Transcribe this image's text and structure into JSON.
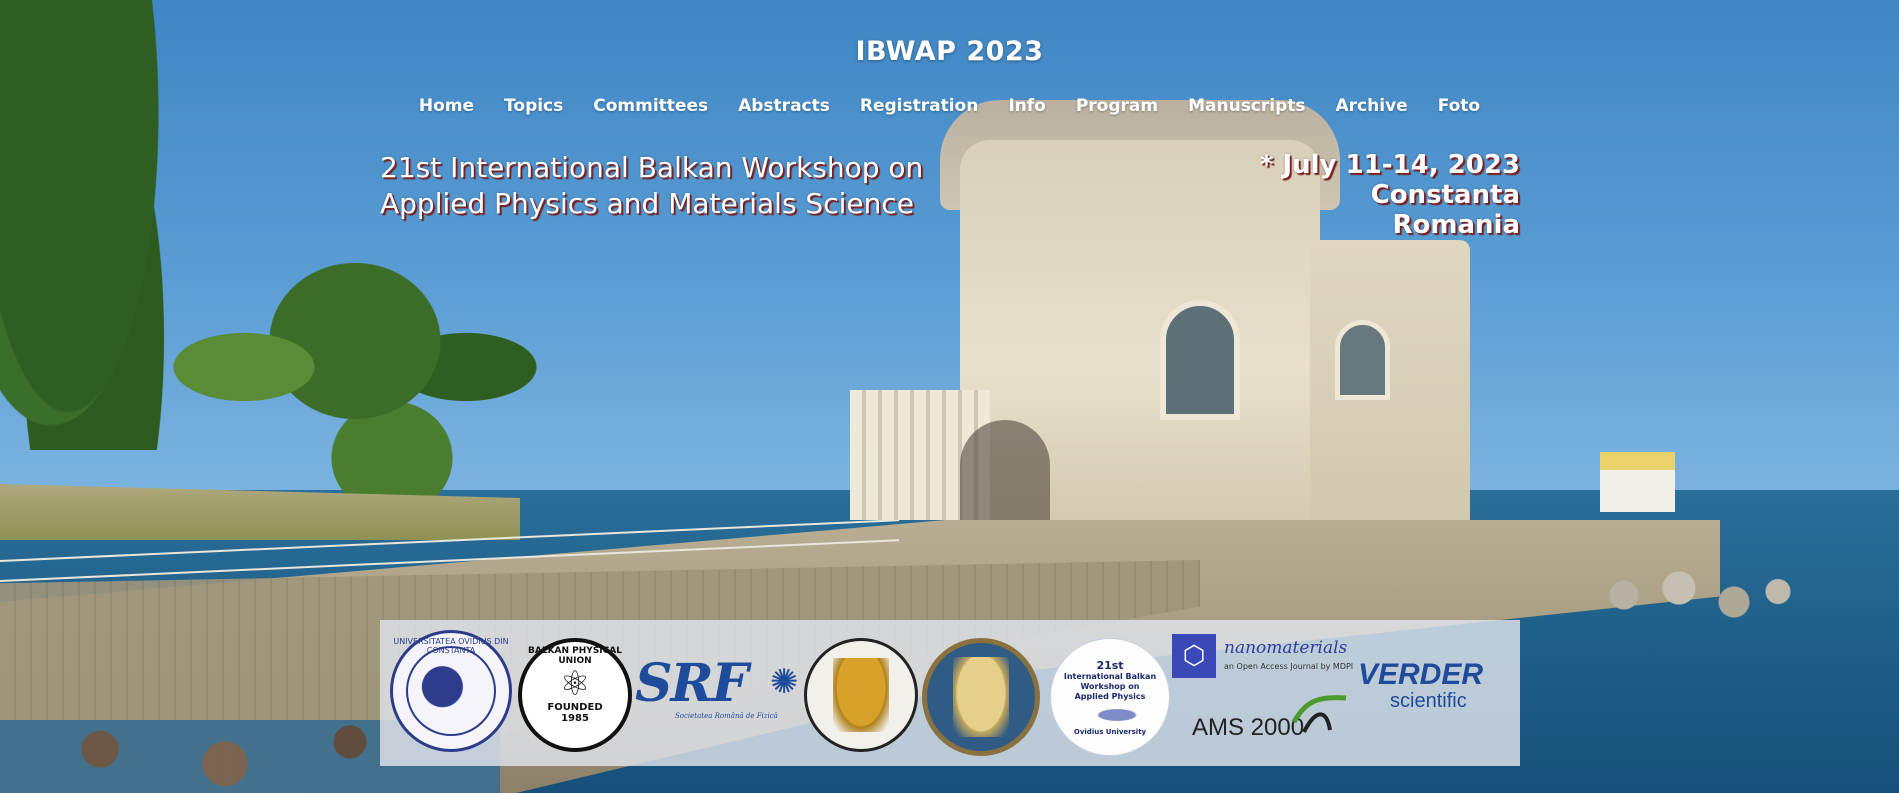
{
  "header": {
    "site_title": "IBWAP 2023",
    "nav": [
      "Home",
      "Topics",
      "Committees",
      "Abstracts",
      "Registration",
      "Info",
      "Program",
      "Manuscripts",
      "Archive",
      "Foto"
    ]
  },
  "hero": {
    "workshop_line1": "21st International Balkan Workshop on",
    "workshop_line2": "Applied Physics and Materials Science",
    "date": "* July 11-14, 2023",
    "city": "Constanta",
    "country": "Romania"
  },
  "logos": {
    "ovidius_ring": "UNIVERSITATEA OVIDIUS DIN CONSTANTA",
    "bpu_arc": "BALKAN PHYSICAL UNION",
    "bpu_founded": "FOUNDED",
    "bpu_year": "1985",
    "srf_mark": "SRF",
    "srf_sub": "Societatea Română de Fizică",
    "ibwap_sup": "21st",
    "ibwap_line1": "International Balkan",
    "ibwap_line2": "Workshop on",
    "ibwap_line3": "Applied Physics",
    "ibwap_univ": "Ovidius University",
    "nanomaterials": "nanomaterials",
    "nanomaterials_sub": "an Open Access Journal by MDPI",
    "ams": "AMS 2000",
    "verder": "VERDER",
    "scientific": "scientific"
  },
  "colors": {
    "title_shadow": "#7a1e1e",
    "logo_strip": "#e1e4ec",
    "sky": "#4a8fc9",
    "sea": "#1f5f88"
  }
}
